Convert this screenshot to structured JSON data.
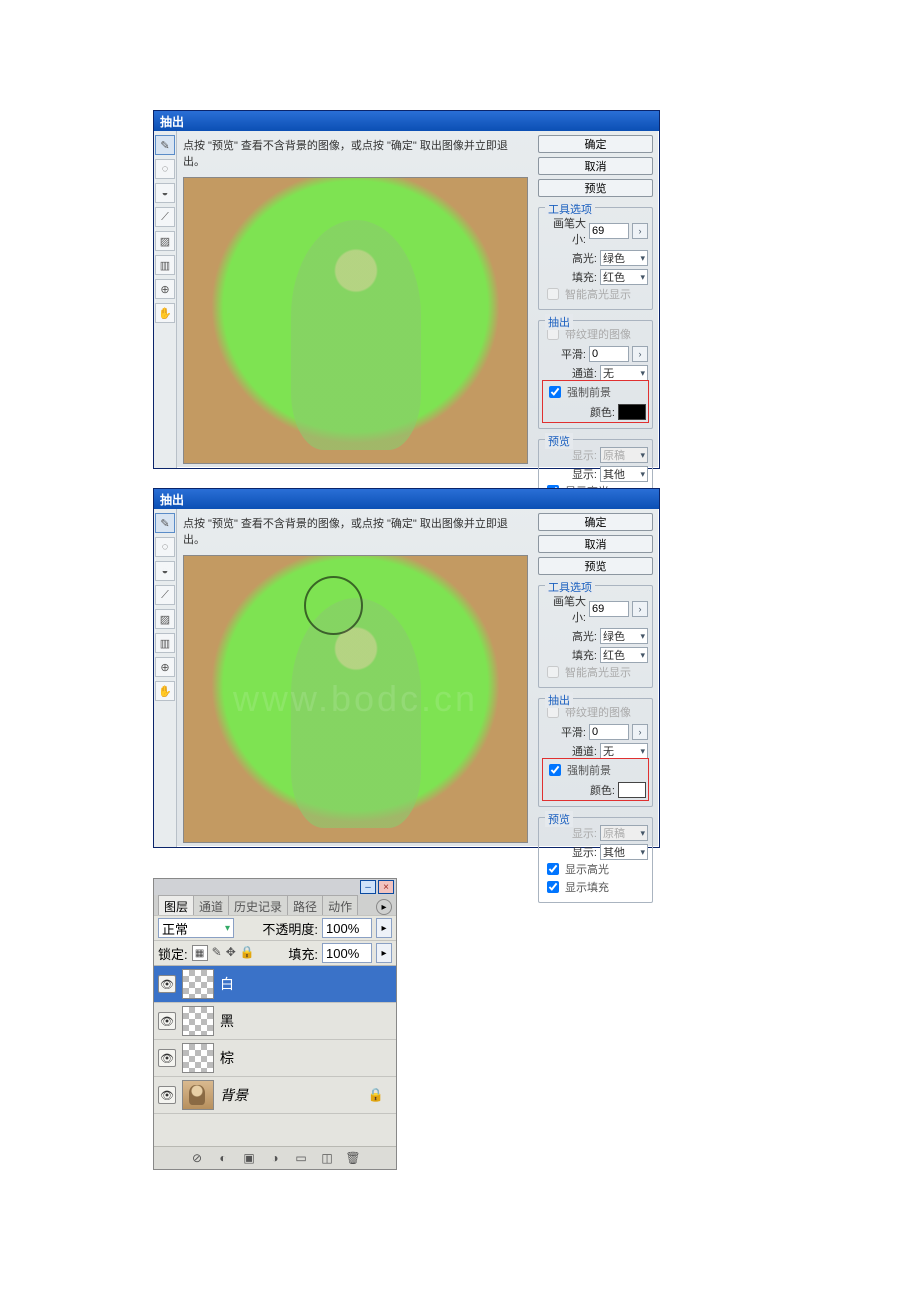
{
  "extract": {
    "title": "抽出",
    "hint": "点按 \"预览\" 查看不含背景的图像，或点按 \"确定\" 取出图像并立即退出。",
    "buttons": {
      "ok": "确定",
      "cancel": "取消",
      "preview": "预览"
    },
    "tool_options": {
      "title": "工具选项",
      "brush_size_label": "画笔大小:",
      "brush_size": "69",
      "highlight_label": "高光:",
      "highlight_value": "绿色",
      "fill_label": "填充:",
      "fill_value": "红色",
      "smart_highlight": "智能高光显示"
    },
    "extraction": {
      "title": "抽出",
      "textured_label": "带纹理的图像",
      "smooth_label": "平滑:",
      "smooth_value": "0",
      "channel_label": "通道:",
      "channel_value": "无",
      "force_fg": "强制前景",
      "color_label": "颜色:"
    },
    "preview_group": {
      "title": "预览",
      "show_label": "显示:",
      "show_value": "原稿",
      "display_label": "显示:",
      "display_value": "其他",
      "show_highlight": "显示高光",
      "show_fill": "显示填充"
    },
    "tools": [
      "✎",
      "◌",
      "◒",
      "⟋",
      "▨",
      "▥",
      "⊕",
      "✋"
    ]
  },
  "layers_panel": {
    "tabs": [
      "图层",
      "通道",
      "历史记录",
      "路径",
      "动作"
    ],
    "blend_mode": "正常",
    "opacity_label": "不透明度:",
    "opacity_value": "100%",
    "lock_label": "锁定:",
    "fill_label": "填充:",
    "fill_value": "100%",
    "layers": [
      {
        "name": "白"
      },
      {
        "name": "黑"
      },
      {
        "name": "棕"
      },
      {
        "name": "背景",
        "italic": true,
        "locked": true
      }
    ],
    "footer_icons": [
      "⊘",
      "◐",
      "▣",
      "◑",
      "▭",
      "◫",
      "🗑"
    ]
  }
}
